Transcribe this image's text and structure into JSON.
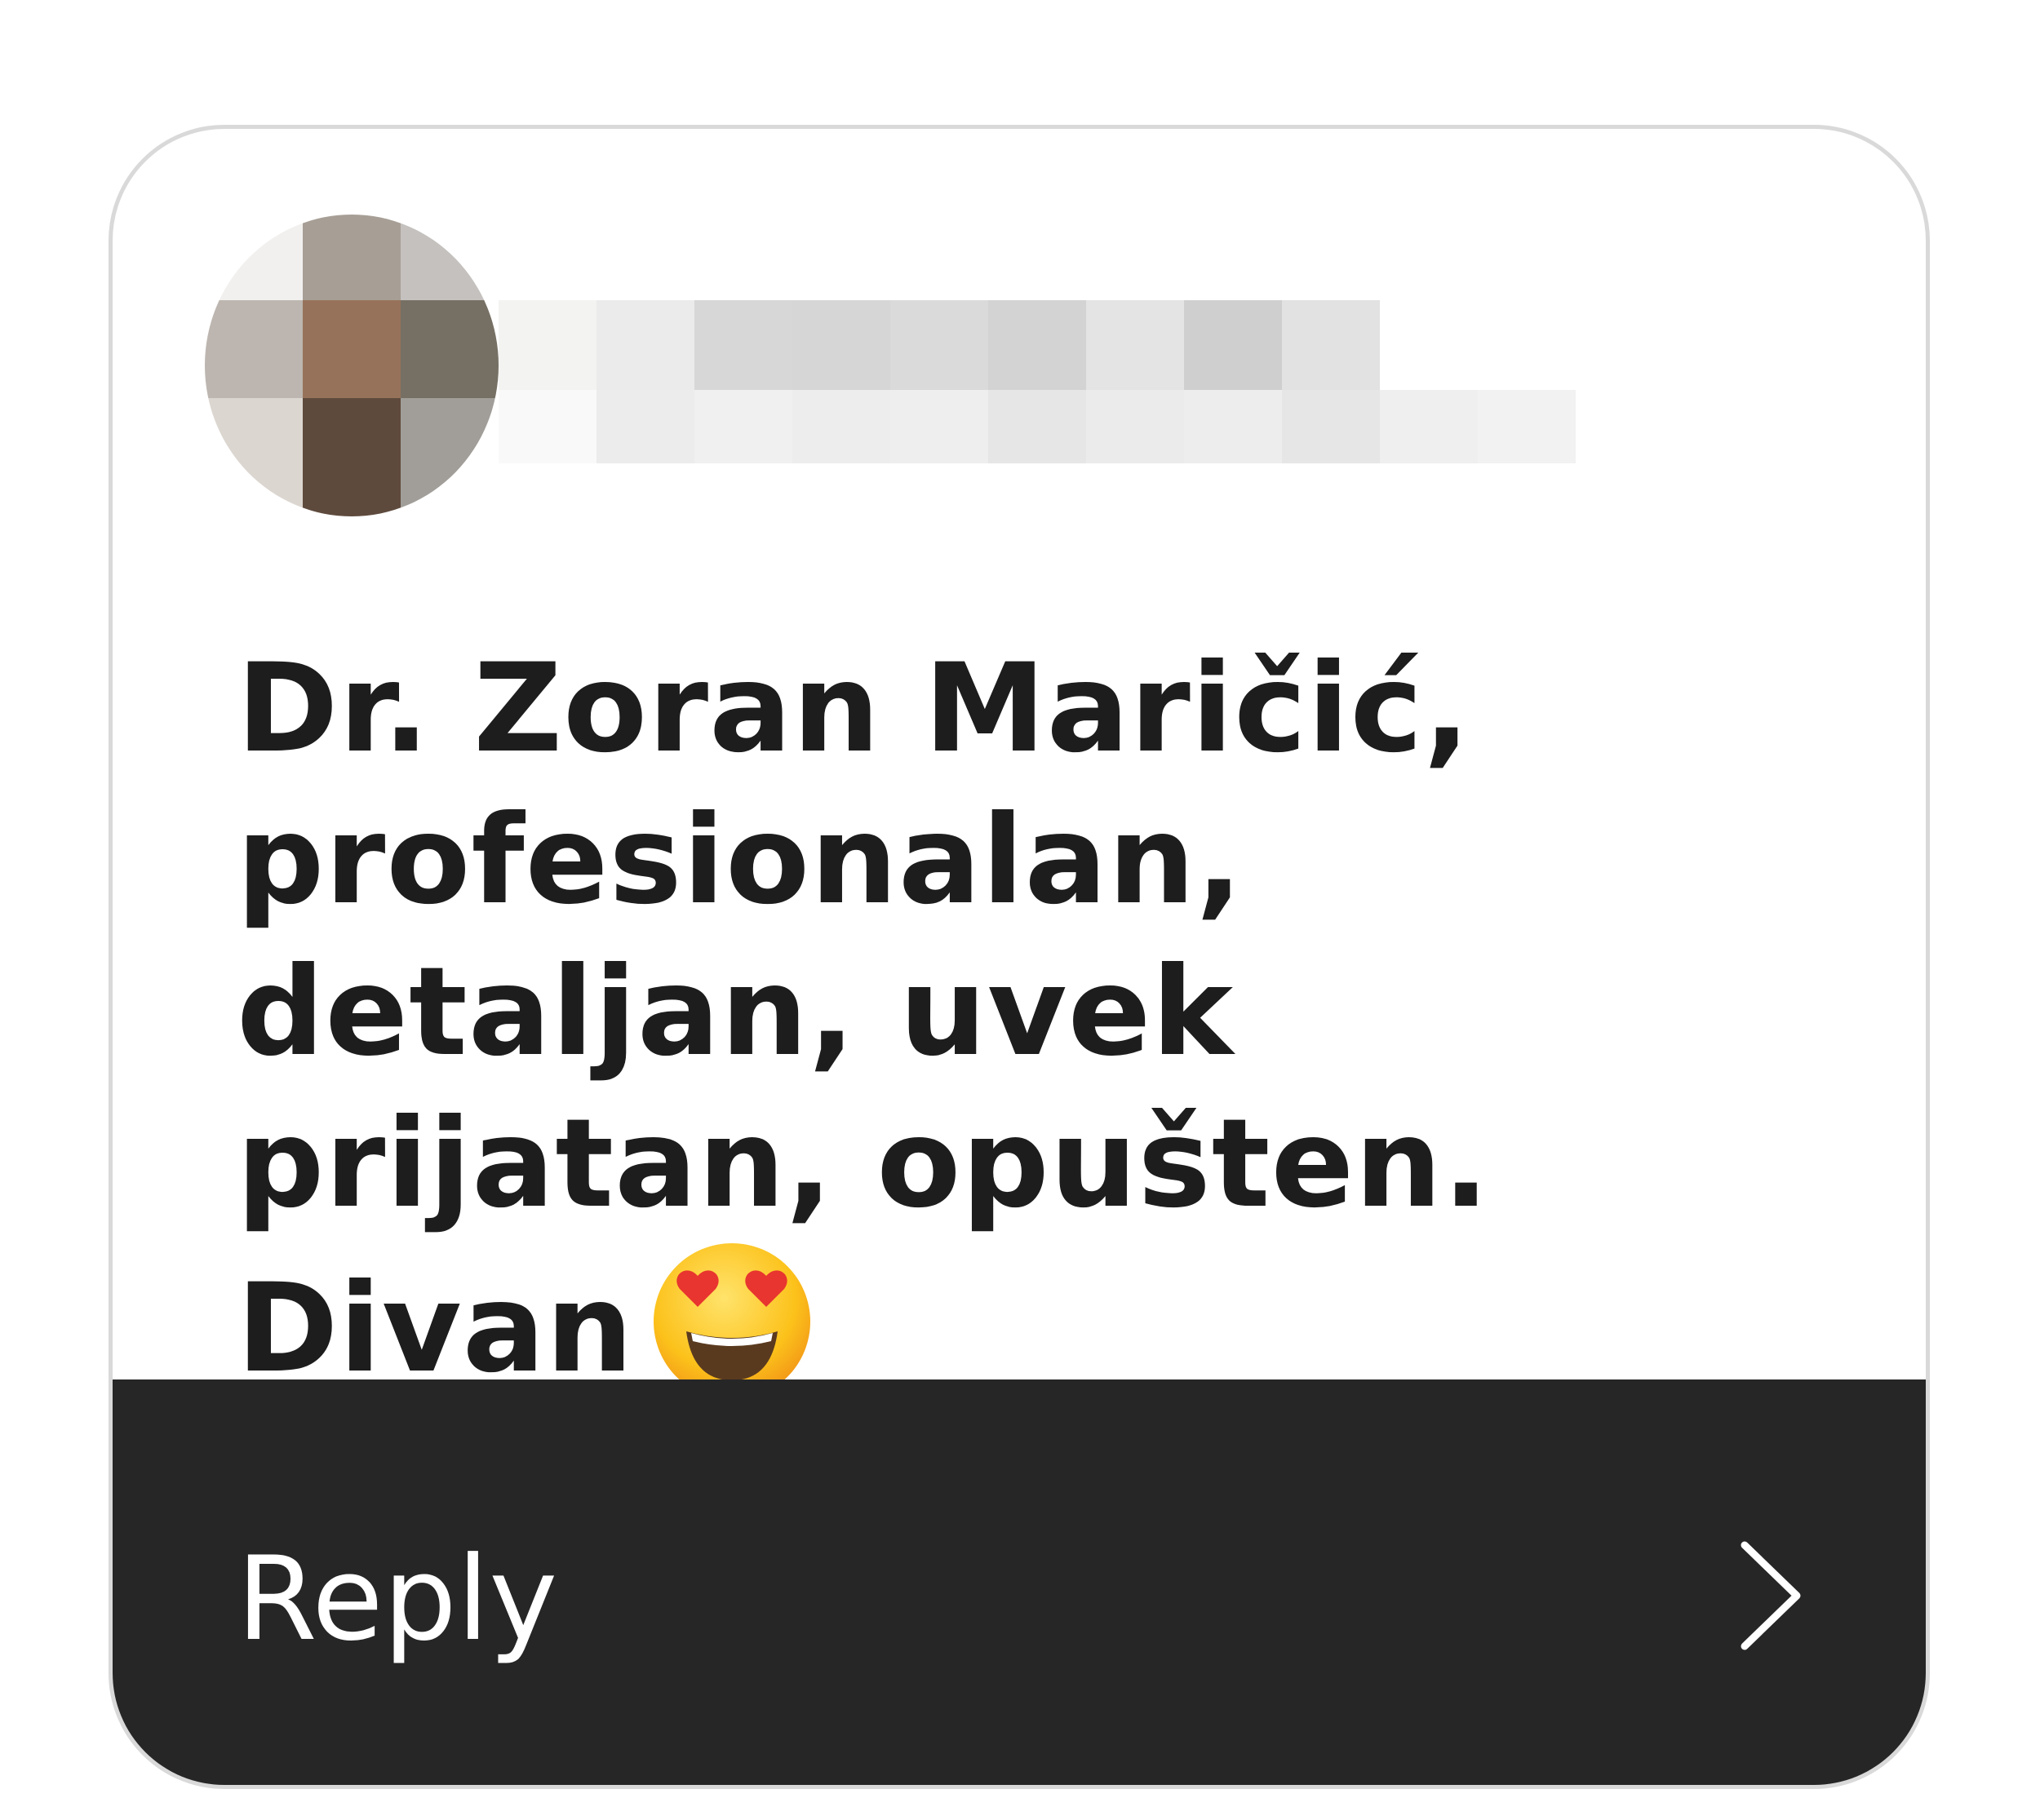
{
  "comment": {
    "author": {
      "avatar_icon": "blurred-avatar-icon",
      "username_hidden": true
    },
    "text": "Dr. Zoran Maričić, profesionalan, detaljan, uvek prijatan, opušten. Divan",
    "emoji": "smiling-face-with-heart-eyes-icon"
  },
  "action": {
    "reply_label": "Reply",
    "chevron_icon": "chevron-right-icon"
  },
  "colors": {
    "card_border": "#d9d9d9",
    "reply_bar": "#262626",
    "text": "#1d1d1d",
    "reply_text": "#ffffff"
  }
}
